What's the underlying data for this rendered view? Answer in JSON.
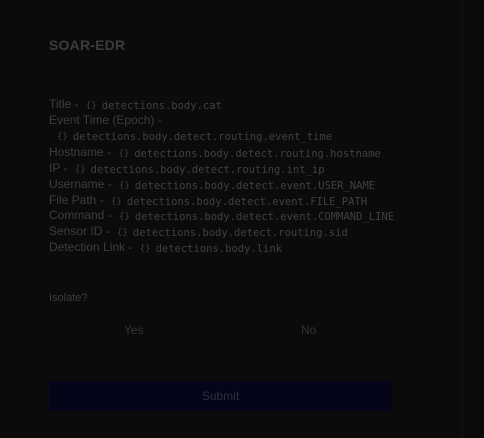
{
  "form": {
    "title": "SOAR-EDR",
    "fields": [
      {
        "label": "Title -",
        "value": "detections.body.cat"
      },
      {
        "label": "Event Time (Epoch) -",
        "value": "detections.body.detect.routing.event_time"
      },
      {
        "label": "Hostname -",
        "value": "detections.body.detect.routing.hostname"
      },
      {
        "label": "IP -",
        "value": "detections.body.detect.routing.int_ip"
      },
      {
        "label": "Username -",
        "value": "detections.body.detect.event.USER_NAME"
      },
      {
        "label": "File Path -",
        "value": "detections.body.detect.event.FILE_PATH"
      },
      {
        "label": "Command -",
        "value": "detections.body.detect.event.COMMAND_LINE"
      },
      {
        "label": "Sensor ID -",
        "value": "detections.body.detect.routing.sid"
      },
      {
        "label": "Detection Link -",
        "value": "detections.body.link"
      }
    ],
    "template_icon": "curly-braces-icon",
    "brace_glyph": "{}",
    "isolate": {
      "label": "Isolate?",
      "options": [
        "Yes",
        "No"
      ]
    },
    "submit_label": "Submit"
  },
  "colors": {
    "background": "#0a0a0a",
    "submit_bg": "#05051a"
  }
}
